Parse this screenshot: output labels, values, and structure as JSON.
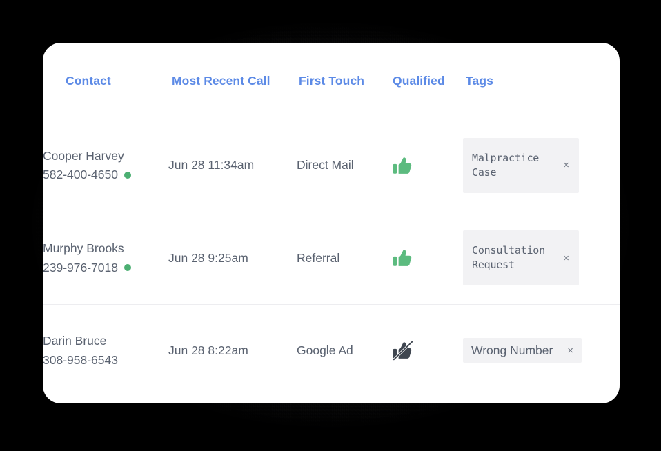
{
  "table": {
    "columns": [
      {
        "key": "contact",
        "label": "Contact"
      },
      {
        "key": "call",
        "label": "Most Recent Call"
      },
      {
        "key": "touch",
        "label": "First Touch"
      },
      {
        "key": "qualified",
        "label": "Qualified"
      },
      {
        "key": "tags",
        "label": "Tags"
      }
    ],
    "rows": [
      {
        "name": "Cooper Harvey",
        "phone": "582-400-4650",
        "status_dot": "online",
        "most_recent_call": "Jun 28 11:34am",
        "first_touch": "Direct Mail",
        "qualified_icon": "thumbs-up-icon",
        "qualified_state": "qualified",
        "tag": {
          "label": "Malpractice Case",
          "remove_label": "×",
          "style": "mono",
          "lines": 2
        }
      },
      {
        "name": "Murphy Brooks",
        "phone": "239-976-7018",
        "status_dot": "online",
        "most_recent_call": "Jun 28 9:25am",
        "first_touch": "Referral",
        "qualified_icon": "thumbs-up-icon",
        "qualified_state": "qualified",
        "tag": {
          "label": "Consultation Request",
          "remove_label": "×",
          "style": "mono",
          "lines": 2
        }
      },
      {
        "name": "Darin Bruce",
        "phone": "308-958-6543",
        "status_dot": "none",
        "most_recent_call": "Jun 28 8:22am",
        "first_touch": "Google Ad",
        "qualified_icon": "thumbs-up-slash-icon",
        "qualified_state": "not-qualified",
        "tag": {
          "label": "Wrong Number",
          "remove_label": "×",
          "style": "sans",
          "lines": 1
        }
      }
    ]
  },
  "colors": {
    "header_text": "#5c8ae6",
    "body_text": "#5a6270",
    "status_dot": "#4caf72",
    "thumb_up": "#5cbb7f",
    "thumb_down": "#3f4650",
    "tag_background": "#f2f2f4",
    "divider": "#ededf0",
    "card_background": "#ffffff",
    "page_background": "#000000"
  }
}
